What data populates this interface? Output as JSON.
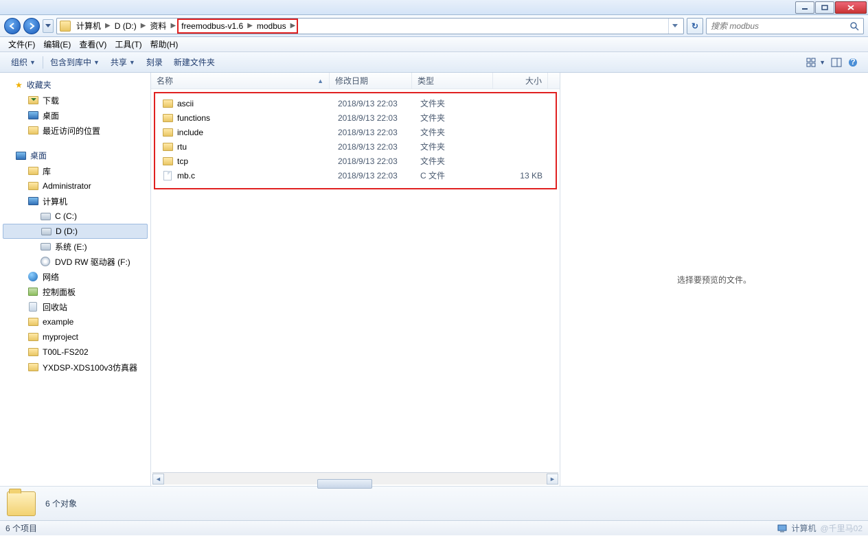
{
  "window": {
    "min": "",
    "max": "",
    "close": ""
  },
  "breadcrumb": {
    "items": [
      "计算机",
      "D (D:)",
      "资料",
      "freemodbus-v1.6",
      "modbus"
    ],
    "highlight_start": 3
  },
  "nav": {
    "refresh": "↻"
  },
  "search": {
    "placeholder": "搜索 modbus"
  },
  "menus": [
    "文件(F)",
    "编辑(E)",
    "查看(V)",
    "工具(T)",
    "帮助(H)"
  ],
  "toolbar": {
    "organize": "组织",
    "include": "包含到库中",
    "share": "共享",
    "burn": "刻录",
    "new_folder": "新建文件夹"
  },
  "view_icons": {
    "layout": "",
    "preview": "",
    "help": ""
  },
  "columns": {
    "name": "名称",
    "date": "修改日期",
    "type": "类型",
    "size": "大小"
  },
  "files": [
    {
      "name": "ascii",
      "date": "2018/9/13 22:03",
      "type": "文件夹",
      "size": "",
      "icon": "folder"
    },
    {
      "name": "functions",
      "date": "2018/9/13 22:03",
      "type": "文件夹",
      "size": "",
      "icon": "folder"
    },
    {
      "name": "include",
      "date": "2018/9/13 22:03",
      "type": "文件夹",
      "size": "",
      "icon": "folder"
    },
    {
      "name": "rtu",
      "date": "2018/9/13 22:03",
      "type": "文件夹",
      "size": "",
      "icon": "folder"
    },
    {
      "name": "tcp",
      "date": "2018/9/13 22:03",
      "type": "文件夹",
      "size": "",
      "icon": "folder"
    },
    {
      "name": "mb.c",
      "date": "2018/9/13 22:03",
      "type": "C 文件",
      "size": "13 KB",
      "icon": "file"
    }
  ],
  "sidebar": {
    "favorites_label": "收藏夹",
    "favorites": [
      {
        "label": "下载",
        "icon": "down"
      },
      {
        "label": "桌面",
        "icon": "monitor"
      },
      {
        "label": "最近访问的位置",
        "icon": "folder"
      }
    ],
    "desktop_label": "桌面",
    "desktop": [
      {
        "label": "库",
        "icon": "folder",
        "lvl": 2
      },
      {
        "label": "Administrator",
        "icon": "folder",
        "lvl": 2
      },
      {
        "label": "计算机",
        "icon": "monitor",
        "lvl": 2
      },
      {
        "label": "C (C:)",
        "icon": "disk",
        "lvl": 3
      },
      {
        "label": "D (D:)",
        "icon": "disk",
        "lvl": 3,
        "selected": true
      },
      {
        "label": "系统 (E:)",
        "icon": "disk",
        "lvl": 3
      },
      {
        "label": "DVD RW 驱动器 (F:)",
        "icon": "dvd",
        "lvl": 3
      },
      {
        "label": "网络",
        "icon": "net",
        "lvl": 2
      },
      {
        "label": "控制面板",
        "icon": "cpl",
        "lvl": 2
      },
      {
        "label": "回收站",
        "icon": "bin",
        "lvl": 2
      },
      {
        "label": "example",
        "icon": "folder",
        "lvl": 2
      },
      {
        "label": "myproject",
        "icon": "folder",
        "lvl": 2
      },
      {
        "label": "T00L-FS202",
        "icon": "folder",
        "lvl": 2
      },
      {
        "label": "YXDSP-XDS100v3仿真器",
        "icon": "folder",
        "lvl": 2
      }
    ]
  },
  "preview": {
    "message": "选择要预览的文件。"
  },
  "details": {
    "summary": "6 个对象"
  },
  "status": {
    "left": "6 个项目",
    "right_label": "计算机",
    "watermark": "@千里马02"
  }
}
